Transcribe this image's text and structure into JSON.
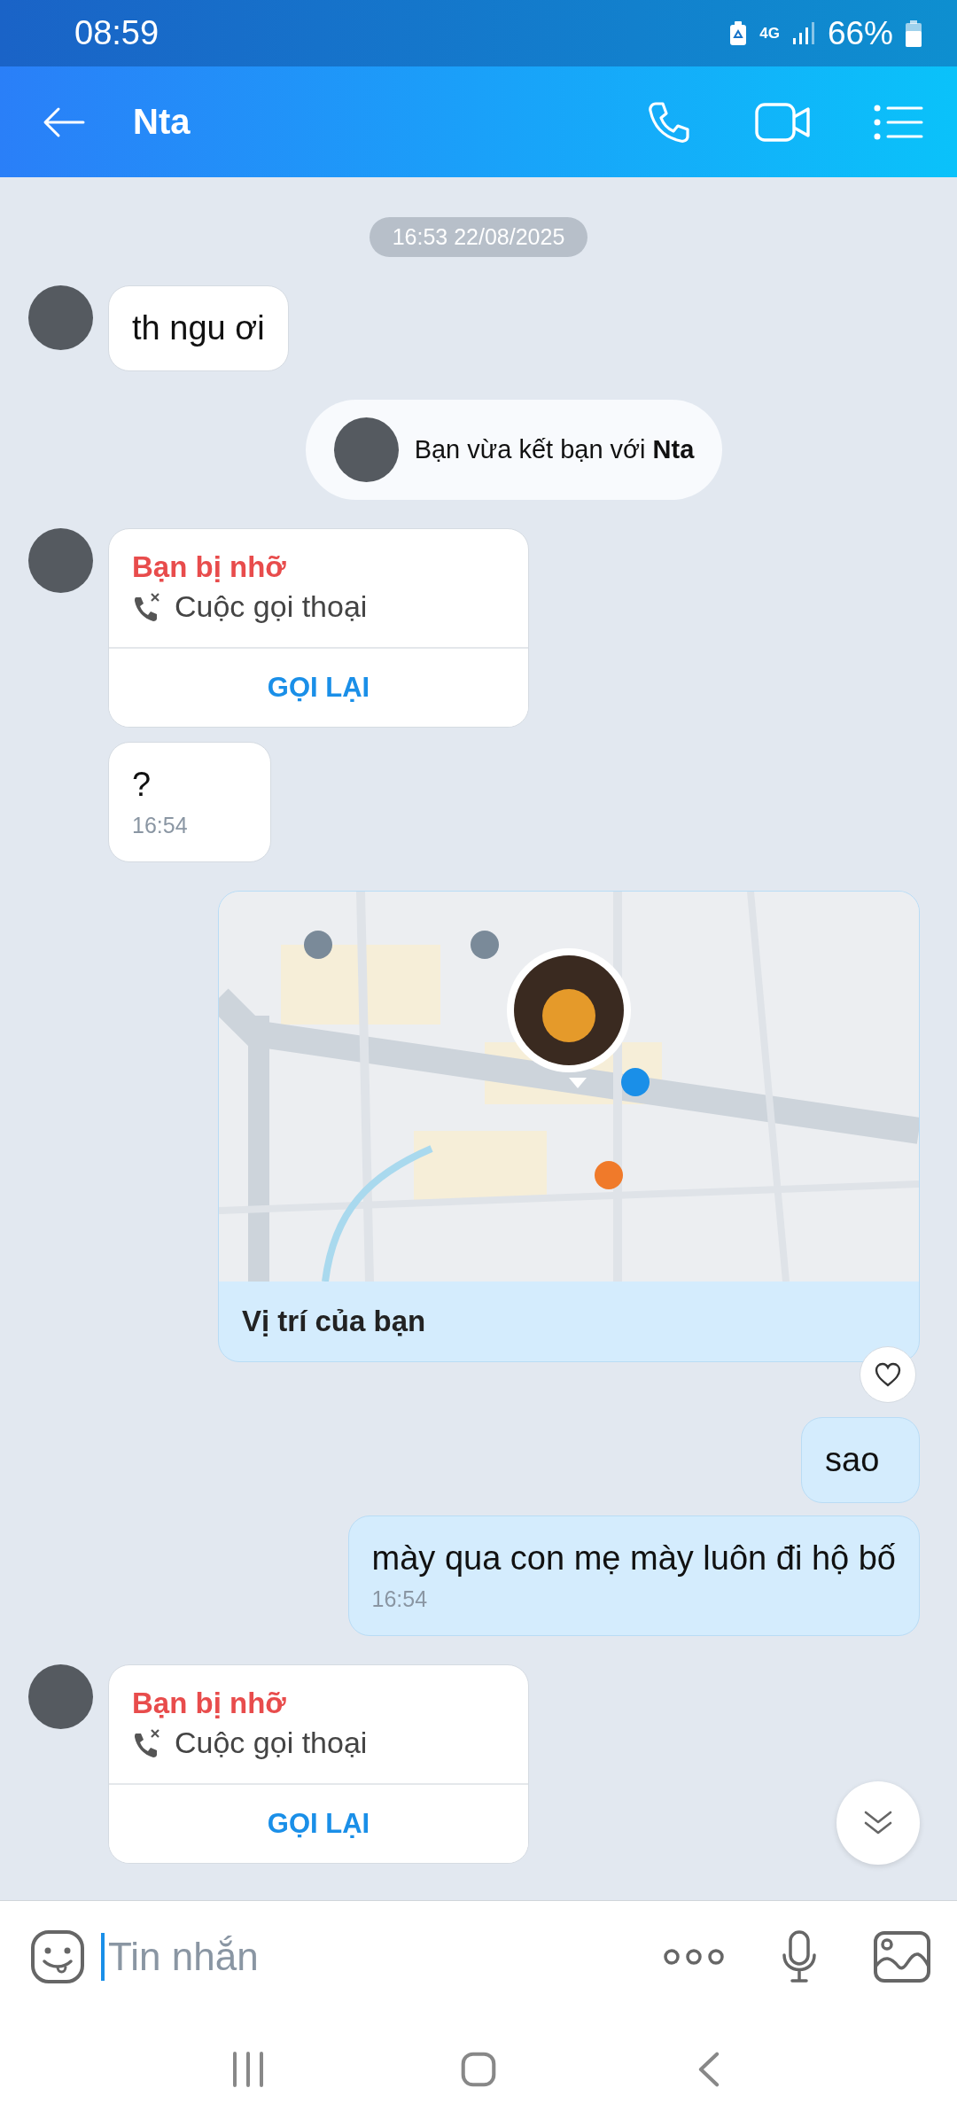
{
  "status_bar": {
    "time": "08:59",
    "network": "4G",
    "battery": "66%"
  },
  "header": {
    "title": "Nta"
  },
  "messages": [
    {
      "kind": "timestamp",
      "text": "16:53 22/08/2025"
    },
    {
      "kind": "text",
      "outgoing": false,
      "show_avatar": true,
      "text": "th ngu ơi"
    },
    {
      "kind": "system",
      "text": "Bạn vừa kết bạn với **Nta**"
    },
    {
      "kind": "missed_call",
      "outgoing": false,
      "show_avatar": true,
      "title": "Bạn bị nhỡ",
      "call_type": "Cuộc gọi thoại",
      "action": "GỌI LẠI"
    },
    {
      "kind": "text",
      "outgoing": false,
      "show_avatar": false,
      "text": "?",
      "time": "16:54"
    },
    {
      "kind": "location",
      "outgoing": true,
      "caption": "Vị trí của bạn",
      "liked": false
    },
    {
      "kind": "text",
      "outgoing": true,
      "text": "sao"
    },
    {
      "kind": "text",
      "outgoing": true,
      "text": "mày qua con mẹ mày luôn đi hộ bố",
      "time": "16:54"
    },
    {
      "kind": "missed_call",
      "outgoing": false,
      "show_avatar": true,
      "title": "Bạn bị nhỡ",
      "call_type": "Cuộc gọi thoại",
      "action": "GỌI LẠI"
    }
  ],
  "composer": {
    "placeholder": "Tin nhắn"
  }
}
